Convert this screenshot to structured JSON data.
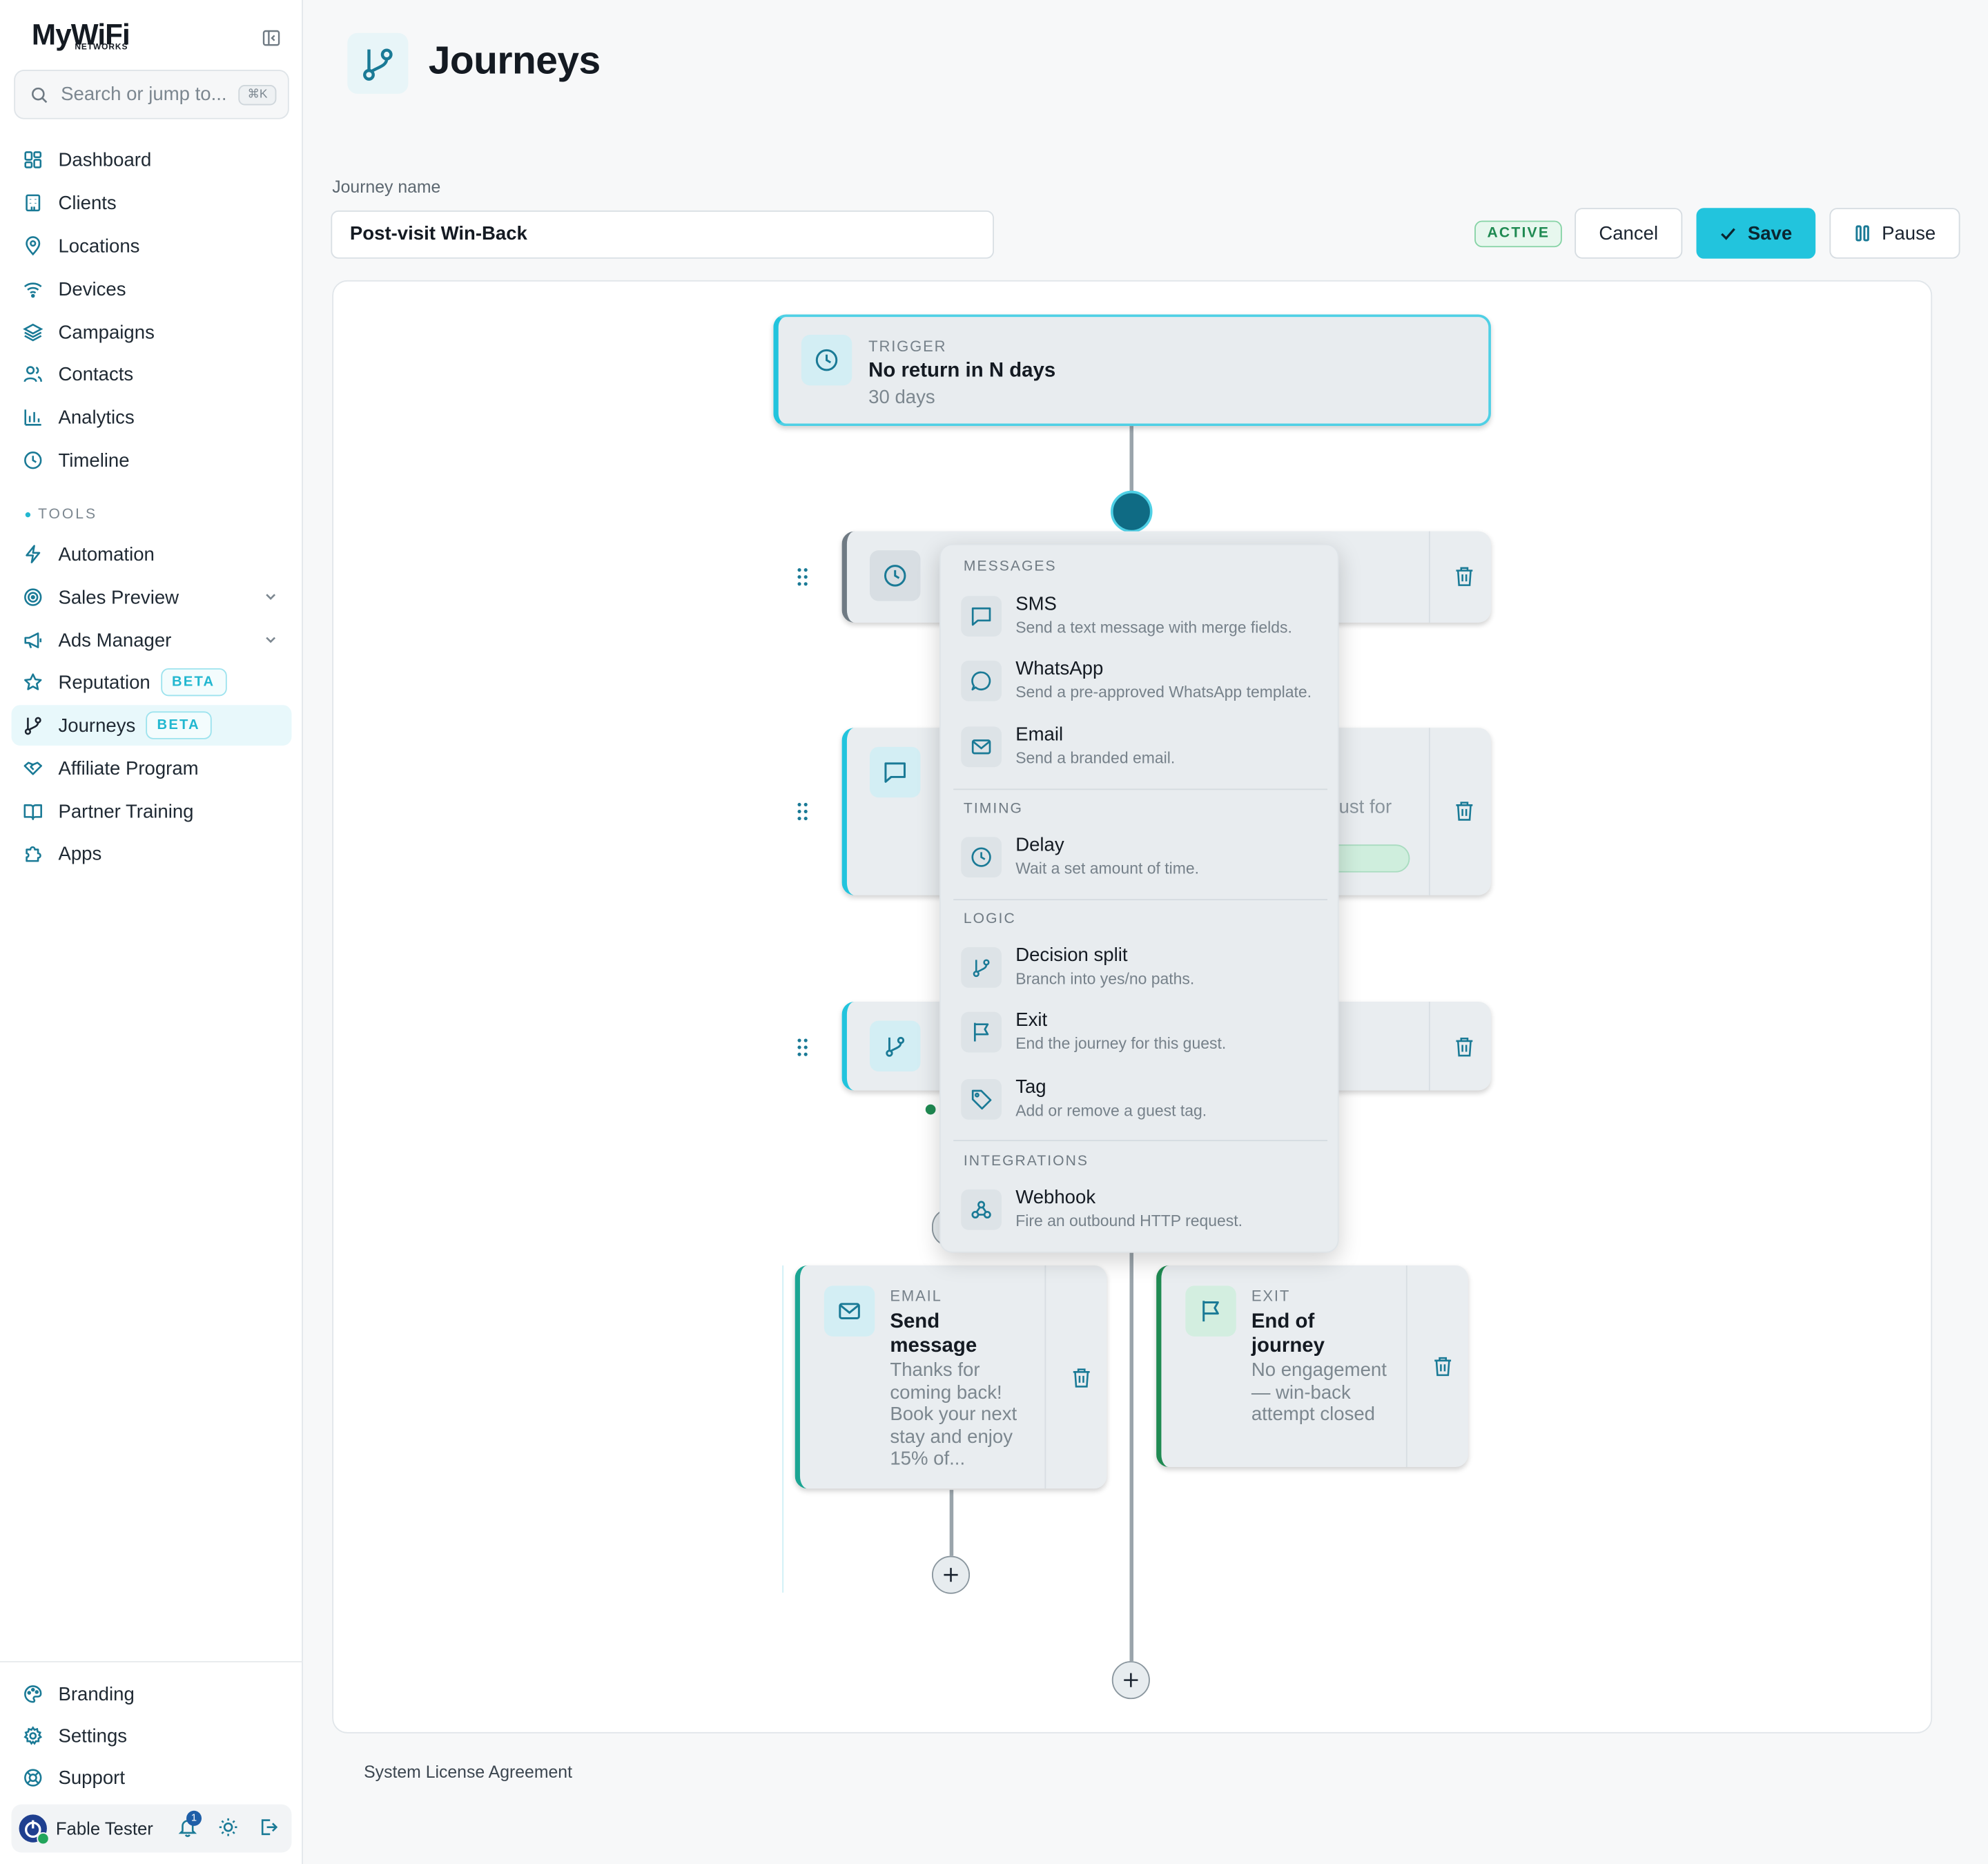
{
  "brand": {
    "logo_word": "MyWiFi",
    "logo_sub": "NETWORKS"
  },
  "search": {
    "placeholder": "Search or jump to...",
    "shortcut": "⌘K"
  },
  "sidebar": {
    "items": [
      {
        "label": "Dashboard",
        "icon": "dashboard-icon"
      },
      {
        "label": "Clients",
        "icon": "building-icon"
      },
      {
        "label": "Locations",
        "icon": "map-pin-icon"
      },
      {
        "label": "Devices",
        "icon": "wifi-icon"
      },
      {
        "label": "Campaigns",
        "icon": "layers-icon"
      },
      {
        "label": "Contacts",
        "icon": "users-icon"
      },
      {
        "label": "Analytics",
        "icon": "bar-chart-icon"
      },
      {
        "label": "Timeline",
        "icon": "clock-icon"
      }
    ],
    "tools_label": "TOOLS",
    "tools": [
      {
        "label": "Automation",
        "icon": "bolt-icon"
      },
      {
        "label": "Sales Preview",
        "icon": "target-icon"
      },
      {
        "label": "Ads Manager",
        "icon": "megaphone-icon"
      },
      {
        "label": "Reputation",
        "icon": "star-icon",
        "badge": "BETA"
      },
      {
        "label": "Journeys",
        "icon": "branch-icon",
        "badge": "BETA"
      },
      {
        "label": "Affiliate Program",
        "icon": "handshake-icon"
      },
      {
        "label": "Partner Training",
        "icon": "book-icon"
      },
      {
        "label": "Apps",
        "icon": "puzzle-icon"
      }
    ],
    "bottom": [
      {
        "label": "Branding",
        "icon": "palette-icon"
      },
      {
        "label": "Settings",
        "icon": "gear-icon"
      },
      {
        "label": "Support",
        "icon": "lifebuoy-icon"
      }
    ],
    "user": {
      "name": "Fable Tester",
      "notifications": "1"
    }
  },
  "header": {
    "title": "Journeys"
  },
  "form": {
    "name_label": "Journey name",
    "name_value": "Post-visit Win-Back",
    "status": "ACTIVE"
  },
  "actions": {
    "cancel": "Cancel",
    "save": "Save",
    "pause": "Pause"
  },
  "flow": {
    "trigger": {
      "label": "TRIGGER",
      "title": "No return in N days",
      "sub": "30 days"
    },
    "node2_partial": {
      "peek": "ust for"
    },
    "email_node": {
      "label": "EMAIL",
      "title": "Send message",
      "sub": "Thanks for coming back! Book your next stay and enjoy 15% of..."
    },
    "exit_node": {
      "label": "EXIT",
      "title": "End of journey",
      "sub": "No engagement — win-back attempt closed"
    }
  },
  "menu": {
    "groups": {
      "messages": "MESSAGES",
      "timing": "TIMING",
      "logic": "LOGIC",
      "integrations": "INTEGRATIONS"
    },
    "items": {
      "sms": {
        "title": "SMS",
        "desc": "Send a text message with merge fields."
      },
      "whatsapp": {
        "title": "WhatsApp",
        "desc": "Send a pre-approved WhatsApp template."
      },
      "email": {
        "title": "Email",
        "desc": "Send a branded email."
      },
      "delay": {
        "title": "Delay",
        "desc": "Wait a set amount of time."
      },
      "decision": {
        "title": "Decision split",
        "desc": "Branch into yes/no paths."
      },
      "exit": {
        "title": "Exit",
        "desc": "End the journey for this guest."
      },
      "tag": {
        "title": "Tag",
        "desc": "Add or remove a guest tag."
      },
      "webhook": {
        "title": "Webhook",
        "desc": "Fire an outbound HTTP request."
      }
    }
  },
  "footer": {
    "license": "System License Agreement"
  },
  "colors": {
    "accent": "#22c4dd",
    "icon": "#1a7a96",
    "active_green": "#1f8a52"
  }
}
